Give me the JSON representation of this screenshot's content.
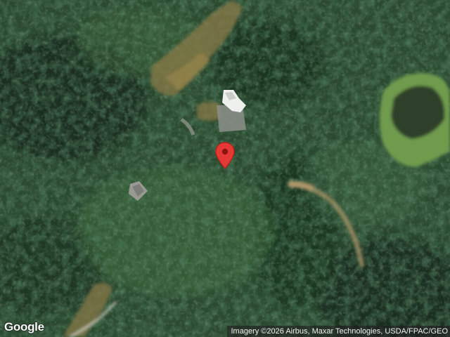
{
  "map": {
    "type": "satellite",
    "logo": "Google",
    "attribution": "Imagery ©2026 Airbus, Maxar Technologies, USDA/FPAC/GEO",
    "marker_icon": "location-pin-icon",
    "marker_color": "#e53935"
  }
}
